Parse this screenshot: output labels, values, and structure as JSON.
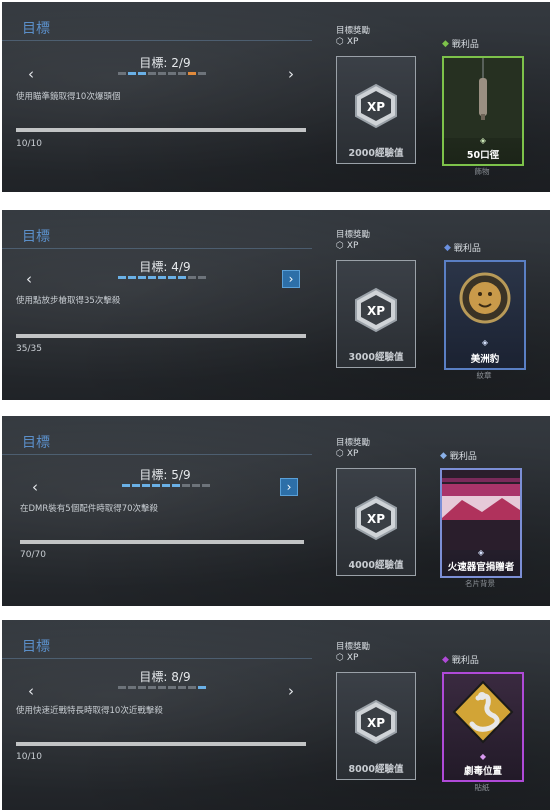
{
  "panels": [
    {
      "objective_title": "目標",
      "goal_label": "目標:  2/9",
      "description": "使用瞄準鏡取得10次爆頭個",
      "progress_text": "10/10",
      "rewards_title": "目標獎勵",
      "xp_label": "XP",
      "loot_label": "戰利品",
      "xp_value": "2000經驗值",
      "loot_name": "50口徑",
      "loot_type": "飾物",
      "loot_color": "#7dc24a",
      "dots": [
        "pending",
        "done",
        "pending",
        "pending",
        "pending",
        "pending",
        "pending",
        "cur",
        "pending"
      ],
      "right_arrow_boxed": false
    },
    {
      "objective_title": "目標",
      "goal_label": "目標:  4/9",
      "description": "使用點放步槍取得35次擊殺",
      "progress_text": "35/35",
      "rewards_title": "目標獎勵",
      "xp_label": "XP",
      "loot_label": "戰利品",
      "xp_value": "3000經驗值",
      "loot_name": "美洲豹",
      "loot_type": "紋章",
      "loot_color": "#5a7fc4",
      "dots": [
        "done",
        "done",
        "done",
        "done",
        "done",
        "done",
        "done",
        "pending",
        "pending"
      ],
      "right_arrow_boxed": true
    },
    {
      "objective_title": "目標",
      "goal_label": "目標:  5/9",
      "description": "在DMR裝有5個配件時取得70次擊殺",
      "progress_text": "70/70",
      "rewards_title": "目標獎勵",
      "xp_label": "XP",
      "loot_label": "戰利品",
      "xp_value": "4000經驗值",
      "loot_name": "火速器官捐贈者",
      "loot_type": "名片背景",
      "loot_color": "#7c8fd6",
      "dots": [
        "done",
        "done",
        "done",
        "done",
        "done",
        "done",
        "pending",
        "pending",
        "pending"
      ],
      "right_arrow_boxed": true
    },
    {
      "objective_title": "目標",
      "goal_label": "目標:  8/9",
      "description": "使用快速近戰特長時取得10次近戰擊殺",
      "progress_text": "10/10",
      "rewards_title": "目標獎勵",
      "xp_label": "XP",
      "loot_label": "戰利品",
      "xp_value": "8000經驗值",
      "loot_name": "劇毒位置",
      "loot_type": "貼紙",
      "loot_color": "#b04ad8",
      "dots": [
        "pending",
        "pending",
        "pending",
        "pending",
        "pending",
        "pending",
        "pending",
        "pending",
        "done"
      ],
      "right_arrow_boxed": false
    }
  ]
}
